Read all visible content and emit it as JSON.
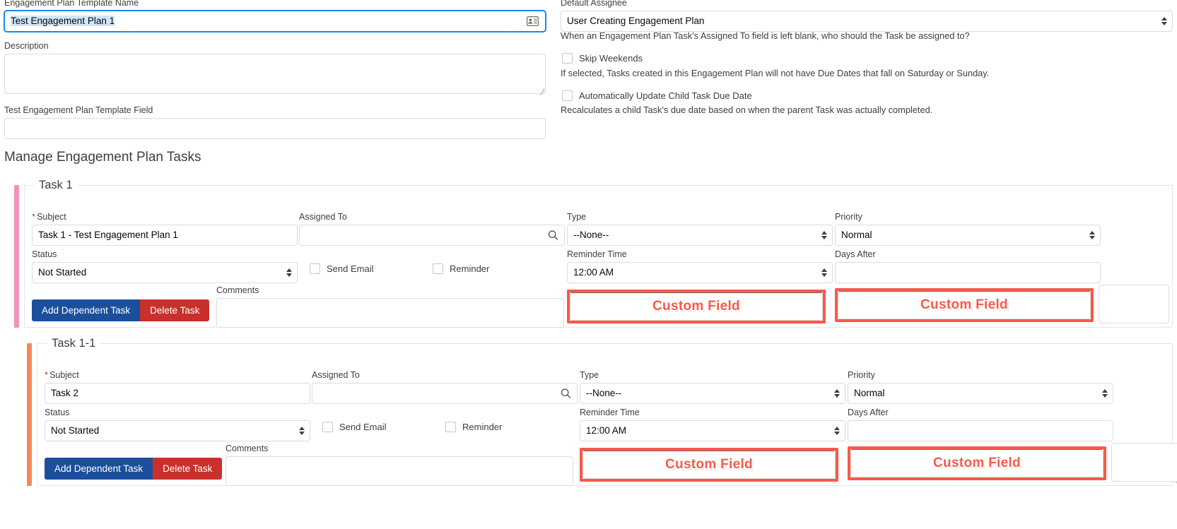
{
  "header": {
    "plan_name_label": "Engagement Plan Template Name",
    "plan_name_value": "Test Engagement Plan 1",
    "plan_name_icon": "contact-card-icon",
    "description_label": "Description",
    "description_value": "",
    "template_field_label": "Test Engagement Plan Template Field",
    "template_field_value": "",
    "default_assignee_label": "Default Assignee",
    "default_assignee_value": "User Creating Engagement Plan",
    "default_assignee_help": "When an Engagement Plan Task's Assigned To field is left blank, who should the Task be assigned to?",
    "skip_weekends_label": "Skip Weekends",
    "skip_weekends_help": "If selected, Tasks created in this Engagement Plan will not have Due Dates that fall on Saturday or Sunday.",
    "auto_update_label": "Automatically Update Child Task Due Date",
    "auto_update_help": "Recalculates a child Task's due date based on when the parent Task was actually completed."
  },
  "section": {
    "title": "Manage Engagement Plan Tasks"
  },
  "labels": {
    "subject": "Subject",
    "assigned_to": "Assigned To",
    "type": "Type",
    "priority": "Priority",
    "status": "Status",
    "send_email": "Send Email",
    "reminder": "Reminder",
    "reminder_time": "Reminder Time",
    "days_after": "Days After",
    "comments": "Comments",
    "required_marker": "*",
    "add_dependent_task": "Add Dependent Task",
    "delete_task": "Delete Task",
    "custom_field": "Custom Field"
  },
  "colors": {
    "accent_task1": "#f291b9",
    "accent_task2": "#f08a5d",
    "button_blue": "#1b4f9c",
    "button_red": "#c9302c",
    "custom_field_red": "#f9594a",
    "focus_blue": "#1589ee"
  },
  "tasks": [
    {
      "legend": "Task 1",
      "accent": "#f291b9",
      "subject": "Task 1 - Test Engagement Plan 1",
      "assigned_to": "",
      "type": "--None--",
      "priority": "Normal",
      "status": "Not Started",
      "send_email_checked": false,
      "reminder_checked": false,
      "reminder_time": "12:00 AM",
      "days_after": "",
      "comments": "",
      "custom_field_1": "Custom Field",
      "custom_field_2": "Custom Field"
    },
    {
      "legend": "Task 1-1",
      "accent": "#f08a5d",
      "subject": "Task 2",
      "assigned_to": "",
      "type": "--None--",
      "priority": "Normal",
      "status": "Not Started",
      "send_email_checked": false,
      "reminder_checked": false,
      "reminder_time": "12:00 AM",
      "days_after": "",
      "comments": "",
      "custom_field_1": "Custom Field",
      "custom_field_2": "Custom Field"
    }
  ]
}
